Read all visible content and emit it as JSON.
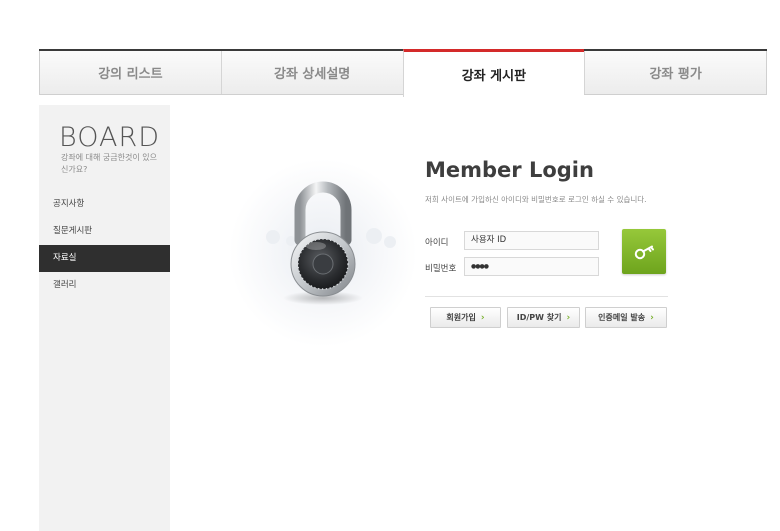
{
  "tabs": [
    {
      "label": "강의 리스트"
    },
    {
      "label": "강좌 상세설명"
    },
    {
      "label": "강좌 게시판"
    },
    {
      "label": "강좌 평가"
    }
  ],
  "active_tab_index": 2,
  "sidebar": {
    "title": "BOARD",
    "desc": "강좌에 대해 궁금한것이 있으신가요?",
    "items": [
      {
        "label": "공지사항"
      },
      {
        "label": "질문게시판"
      },
      {
        "label": "자료실"
      },
      {
        "label": "갤러리"
      }
    ],
    "active_index": 2
  },
  "login": {
    "title": "Member Login",
    "description": "저희 사이트에 가입하신 아이디와 비밀번호로 로그인 하실 수 있습니다.",
    "id_label": "아이디",
    "id_value": "사용자 ID",
    "pw_label": "비밀번호",
    "pw_value": "●●●●",
    "submit_icon": "key-icon",
    "buttons": [
      {
        "label": "회원가입"
      },
      {
        "label": "ID/PW 찾기"
      },
      {
        "label": "인증메일 발송"
      }
    ]
  },
  "colors": {
    "active_tab_accent": "#d42a2a",
    "login_button": "#7fb12a",
    "sidebar_active": "#2f2f2f"
  }
}
